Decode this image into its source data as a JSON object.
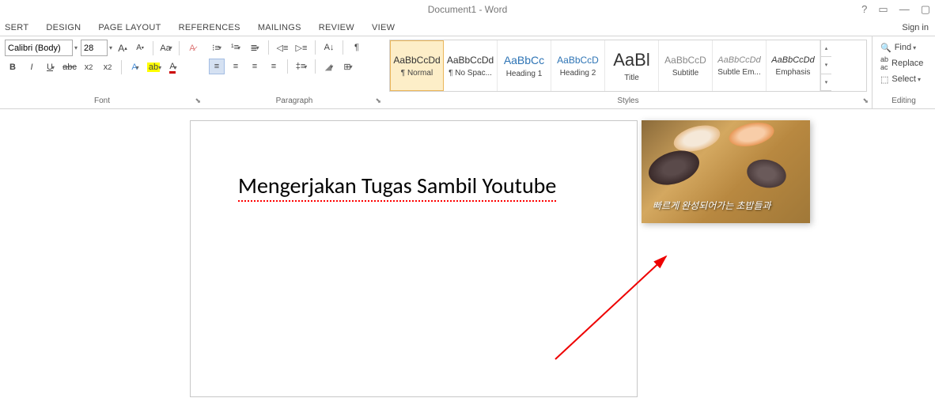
{
  "window": {
    "title": "Document1 - Word",
    "signin": "Sign in"
  },
  "tabs": [
    "SERT",
    "DESIGN",
    "PAGE LAYOUT",
    "REFERENCES",
    "MAILINGS",
    "REVIEW",
    "VIEW"
  ],
  "font": {
    "family": "Calibri (Body)",
    "size": "28",
    "group_label": "Font"
  },
  "paragraph": {
    "group_label": "Paragraph"
  },
  "styles": {
    "group_label": "Styles",
    "items": [
      {
        "preview": "AaBbCcDd",
        "name": "¶ Normal",
        "selected": true,
        "size": "12px",
        "color": "#333"
      },
      {
        "preview": "AaBbCcDd",
        "name": "¶ No Spac...",
        "size": "12px",
        "color": "#333"
      },
      {
        "preview": "AaBbCc",
        "name": "Heading 1",
        "size": "14px",
        "color": "#2e74b5"
      },
      {
        "preview": "AaBbCcD",
        "name": "Heading 2",
        "size": "12px",
        "color": "#2e74b5"
      },
      {
        "preview": "AaBl",
        "name": "Title",
        "size": "22px",
        "color": "#333"
      },
      {
        "preview": "AaBbCcD",
        "name": "Subtitle",
        "size": "12px",
        "color": "#888"
      },
      {
        "preview": "AaBbCcDd",
        "name": "Subtle Em...",
        "size": "11px",
        "color": "#888",
        "italic": true
      },
      {
        "preview": "AaBbCcDd",
        "name": "Emphasis",
        "size": "11px",
        "color": "#333",
        "italic": true
      }
    ]
  },
  "editing": {
    "group_label": "Editing",
    "find": "Find",
    "replace": "Replace",
    "select": "Select"
  },
  "document": {
    "text": "Mengerjakan Tugas Sambil Youtube"
  },
  "pip": {
    "caption": "빠르게 완성되어가는 초밥들과"
  }
}
